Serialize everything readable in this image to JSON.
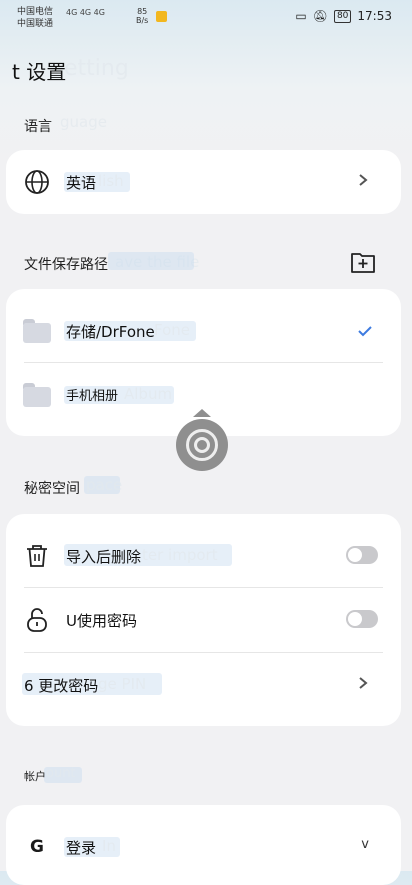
{
  "status_bar": {
    "carrier1": "中国电信",
    "carrier2": "中国联通",
    "signal_text": "4G 4G 4G",
    "speed_value": "85",
    "speed_unit": "B/s",
    "battery": "80",
    "time": "17:53"
  },
  "header": {
    "title": "t 设置",
    "ghost_title": "etting"
  },
  "language_section": {
    "label": "语言",
    "ghost": "guage",
    "item": {
      "label": "英语",
      "ghost": "lish"
    }
  },
  "save_path_section": {
    "label": "文件保存路径",
    "ghost": "ave the file",
    "items": [
      {
        "label": "存储/DrFone",
        "ghost": "Fone",
        "selected": true
      },
      {
        "label": "手机相册",
        "ghost": "Album",
        "selected": false
      }
    ]
  },
  "secret_section": {
    "label": "秘密空间",
    "ghost": "pace",
    "items": [
      {
        "label": "导入后删除",
        "ghost": "ter import",
        "toggle": false
      },
      {
        "label": "U使用密码",
        "toggle": false
      },
      {
        "label": "6 更改密码",
        "ghost": "ge PIN"
      }
    ]
  },
  "account_section": {
    "label": "帐户",
    "ghost": "ount",
    "item": {
      "label": "登录",
      "ghost": "In",
      "icon_letter": "G",
      "trailing": "v"
    }
  }
}
